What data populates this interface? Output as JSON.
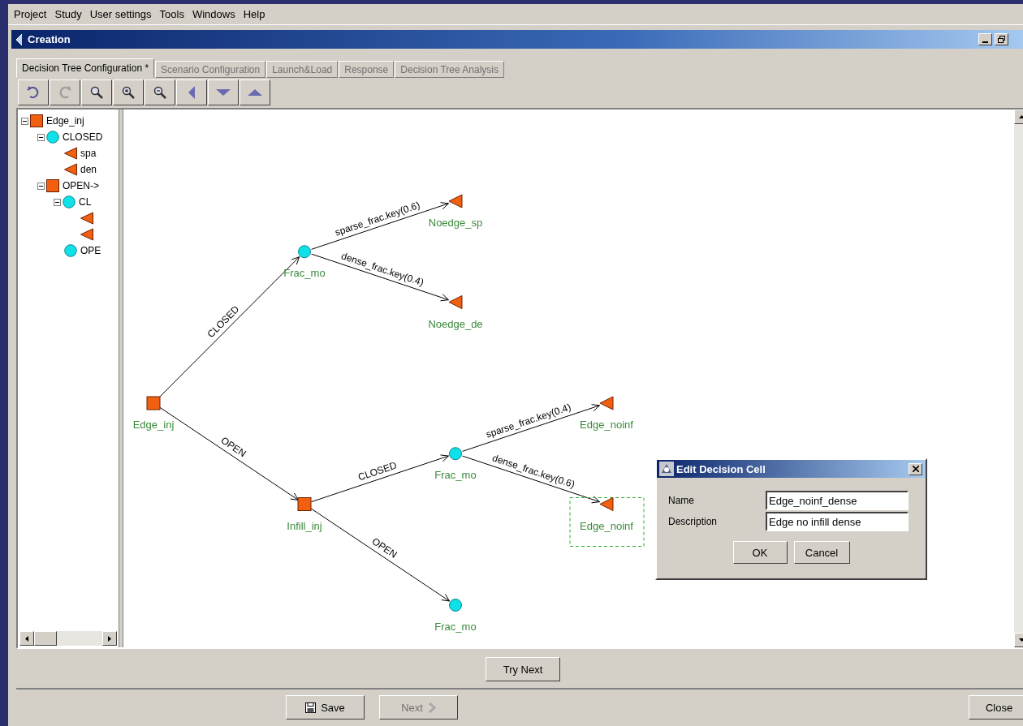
{
  "menu": [
    "Project",
    "Study",
    "User settings",
    "Tools",
    "Windows",
    "Help"
  ],
  "window": {
    "title": "Creation"
  },
  "tabs": [
    {
      "label": "Decision Tree Configuration *",
      "selected": true,
      "disabled": false
    },
    {
      "label": "Scenario Configuration",
      "selected": false,
      "disabled": true
    },
    {
      "label": "Launch&Load",
      "selected": false,
      "disabled": true
    },
    {
      "label": "Response",
      "selected": false,
      "disabled": true
    },
    {
      "label": "Decision Tree Analysis",
      "selected": false,
      "disabled": true
    }
  ],
  "toolbar": [
    {
      "kind": "undo",
      "disabled": false
    },
    {
      "kind": "redo",
      "disabled": true
    },
    {
      "kind": "search",
      "disabled": false
    },
    {
      "kind": "zoom-in",
      "disabled": false
    },
    {
      "kind": "zoom-out",
      "disabled": false
    },
    {
      "kind": "left",
      "disabled": false
    },
    {
      "kind": "down",
      "disabled": false
    },
    {
      "kind": "up",
      "disabled": false
    }
  ],
  "outline": [
    {
      "kind": "decision",
      "label": "Edge_inj",
      "expanded": true,
      "children": [
        {
          "kind": "chance",
          "label": "CLOSED",
          "expanded": true,
          "children": [
            {
              "kind": "end",
              "label": "spa"
            },
            {
              "kind": "end",
              "label": "den"
            }
          ]
        },
        {
          "kind": "decision",
          "label": "OPEN->",
          "expanded": true,
          "children": [
            {
              "kind": "chance",
              "label": "CL",
              "expanded": true,
              "children": [
                {
                  "kind": "end"
                },
                {
                  "kind": "end"
                }
              ]
            },
            {
              "kind": "chance",
              "label": "OPE"
            }
          ]
        }
      ]
    }
  ],
  "diagram": {
    "kind": "decision",
    "label": "Edge_inj",
    "selected": false,
    "children": [
      {
        "kind": "chance",
        "label": "Frac_mo",
        "branch": "CLOSED",
        "selected": false,
        "children": [
          {
            "kind": "end",
            "label": "Noedge_sp",
            "branch": "sparse_frac.key(0.6)",
            "selected": false
          },
          {
            "kind": "end",
            "label": "Noedge_de",
            "branch": "dense_frac.key(0.4)",
            "selected": false
          }
        ]
      },
      {
        "kind": "decision",
        "label": "Infill_inj",
        "branch": "OPEN",
        "selected": false,
        "children": [
          {
            "kind": "chance",
            "label": "Frac_mo",
            "branch": "CLOSED",
            "selected": false,
            "children": [
              {
                "kind": "end",
                "label": "Edge_noinf",
                "branch": "sparse_frac.key(0.4)",
                "selected": false
              },
              {
                "kind": "end",
                "label": "Edge_noinf",
                "branch": "dense_frac.key(0.6)",
                "selected": true
              }
            ]
          },
          {
            "kind": "chance",
            "label": "Frac_mo",
            "branch": "OPEN",
            "selected": false
          }
        ]
      }
    ]
  },
  "try_next": "Try Next",
  "footer": [
    {
      "kind": "save",
      "label": "Save",
      "disabled": false
    },
    {
      "kind": "next",
      "label": "Next",
      "disabled": true
    },
    {
      "kind": "close",
      "label": "Close",
      "disabled": false
    }
  ],
  "dialog": {
    "title": "Edit Decision Cell",
    "fields": [
      {
        "label": "Name",
        "value": "Edge_noinf_dense"
      },
      {
        "label": "Description",
        "value": "Edge no infill dense"
      }
    ],
    "buttons": [
      "OK",
      "Cancel"
    ]
  }
}
